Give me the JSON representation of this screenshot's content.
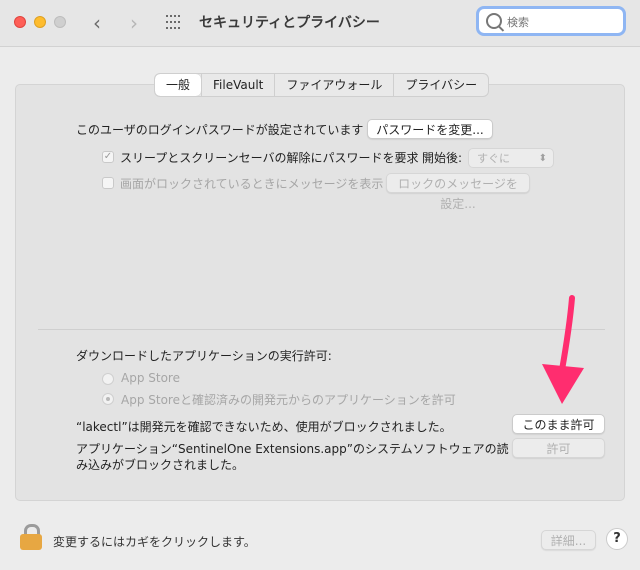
{
  "window": {
    "title": "セキュリティとプライバシー"
  },
  "search": {
    "placeholder": "検索"
  },
  "tabs": [
    {
      "label": "一般",
      "active": true
    },
    {
      "label": "FileVault",
      "active": false
    },
    {
      "label": "ファイアウォール",
      "active": false
    },
    {
      "label": "プライバシー",
      "active": false
    }
  ],
  "general": {
    "password_set_text": "このユーザのログインパスワードが設定されています",
    "change_password_button": "パスワードを変更...",
    "require_password_label": "スリープとスクリーンセーバの解除にパスワードを要求",
    "require_password_checked": true,
    "start_after_label": "開始後:",
    "start_after_value": "すぐに",
    "lock_message_label": "画面がロックされているときにメッセージを表示",
    "lock_message_checked": false,
    "set_lock_message_button": "ロックのメッセージを設定..."
  },
  "downloads": {
    "heading": "ダウンロードしたアプリケーションの実行許可:",
    "options": [
      {
        "label": "App Store",
        "selected": false
      },
      {
        "label": "App Storeと確認済みの開発元からのアプリケーションを許可",
        "selected": true
      }
    ],
    "blocked_1_text": "“lakectl”は開発元を確認できないため、使用がブロックされました。",
    "allow_anyway_button": "このまま許可",
    "blocked_2_text_line1": "アプリケーション“SentinelOne Extensions.app”のシステムソフトウェアの読",
    "blocked_2_text_line2": "み込みがブロックされました。",
    "allow_button": "許可"
  },
  "footer": {
    "lock_text": "変更するにはカギをクリックします。",
    "advanced_button": "詳細...",
    "help_label": "?"
  },
  "colors": {
    "annotation_arrow": "#ff2d6f",
    "search_focus": "#8fb6f3",
    "lock_body": "#e7a742"
  },
  "icons": {
    "back": "chevron-left-icon",
    "forward": "chevron-right-icon",
    "show_all": "grid-icon",
    "search": "search-icon",
    "lock": "lock-icon",
    "arrow": "arrow-annotation-icon"
  }
}
